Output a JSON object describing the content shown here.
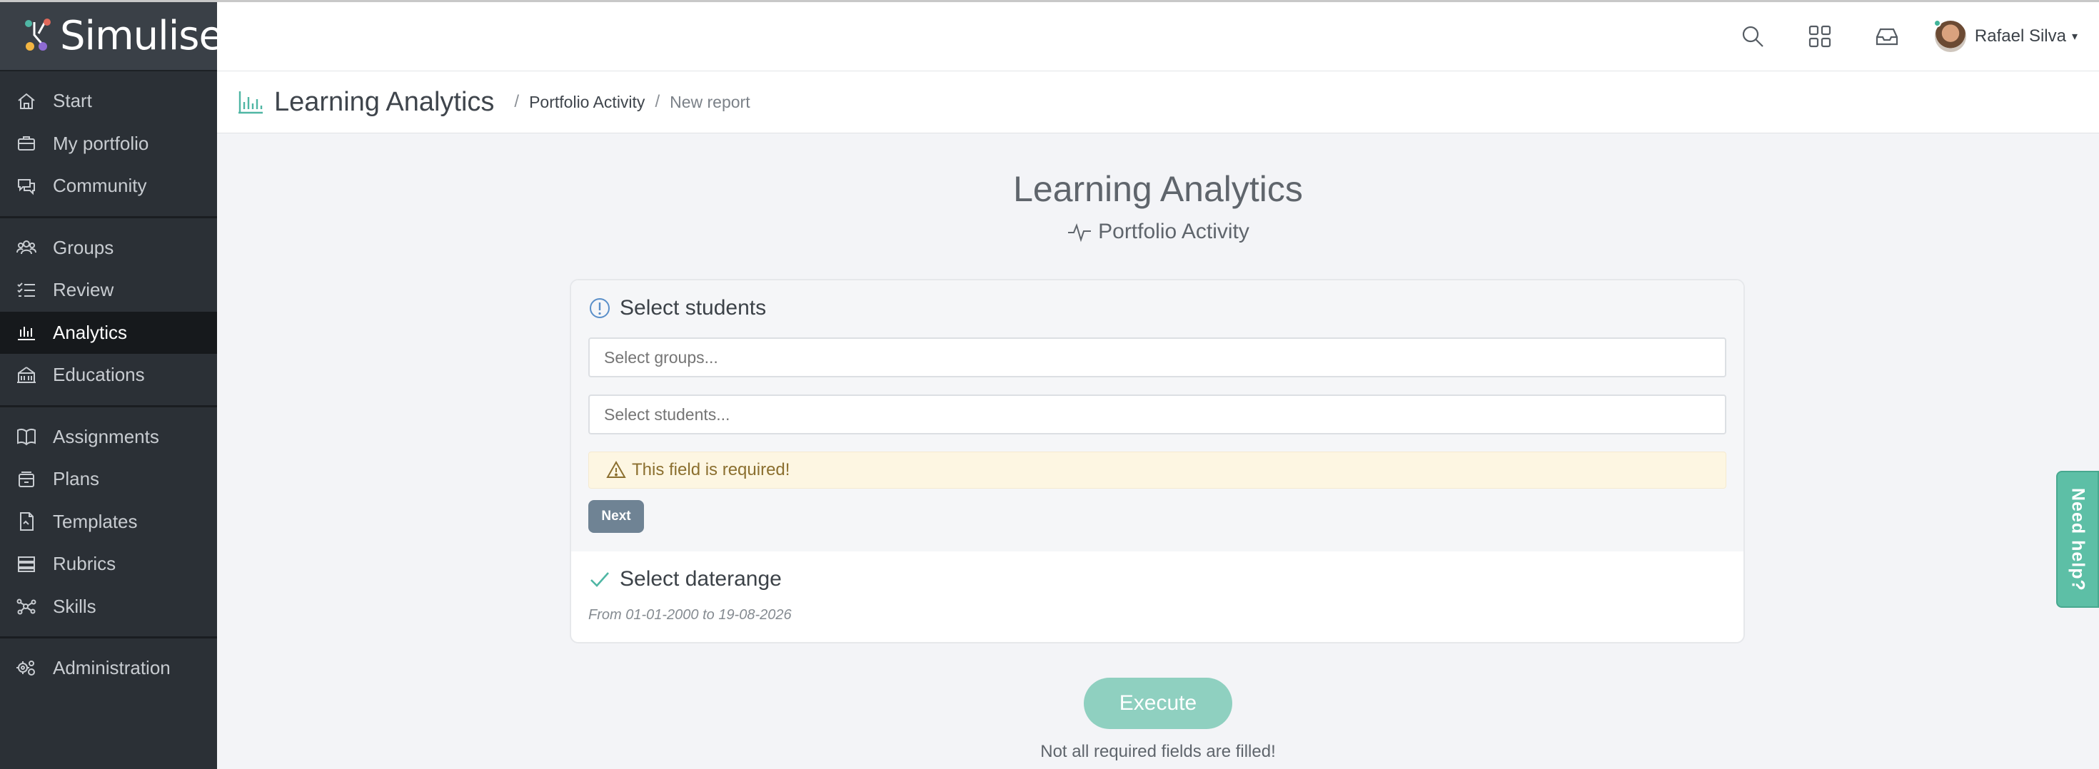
{
  "app": {
    "logo_text": "Simulise"
  },
  "sidebar": {
    "groups": [
      [
        {
          "label": "Start",
          "icon": "home-icon"
        },
        {
          "label": "My portfolio",
          "icon": "briefcase-icon"
        },
        {
          "label": "Community",
          "icon": "chat-icon"
        }
      ],
      [
        {
          "label": "Groups",
          "icon": "users-icon"
        },
        {
          "label": "Review",
          "icon": "checklist-icon"
        },
        {
          "label": "Analytics",
          "icon": "bar-chart-icon",
          "active": true
        },
        {
          "label": "Educations",
          "icon": "school-icon"
        }
      ],
      [
        {
          "label": "Assignments",
          "icon": "book-icon"
        },
        {
          "label": "Plans",
          "icon": "plans-icon"
        },
        {
          "label": "Templates",
          "icon": "document-icon"
        },
        {
          "label": "Rubrics",
          "icon": "rubrics-icon"
        },
        {
          "label": "Skills",
          "icon": "skills-icon"
        }
      ],
      [
        {
          "label": "Administration",
          "icon": "gears-icon"
        }
      ]
    ]
  },
  "topbar": {
    "user_name": "Rafael Silva"
  },
  "breadcrumb": {
    "title": "Learning Analytics",
    "sep": "/",
    "link": "Portfolio Activity",
    "current": "New report"
  },
  "main": {
    "title": "Learning Analytics",
    "subtitle": "Portfolio Activity"
  },
  "step1": {
    "title": "Select students",
    "groups_placeholder": "Select groups...",
    "students_placeholder": "Select students...",
    "alert": "This field is required!",
    "next_label": "Next"
  },
  "step2": {
    "title": "Select daterange",
    "range": "From 01-01-2000 to 19-08-2026"
  },
  "execute_label": "Execute",
  "status_text": "Not all required fields are filled!",
  "help_label": "Need help?",
  "colors": {
    "accent": "#5dbfa6",
    "sidebar": "#2b3036",
    "alert_bg": "#fdf6e2",
    "next_btn": "#6f8394"
  }
}
